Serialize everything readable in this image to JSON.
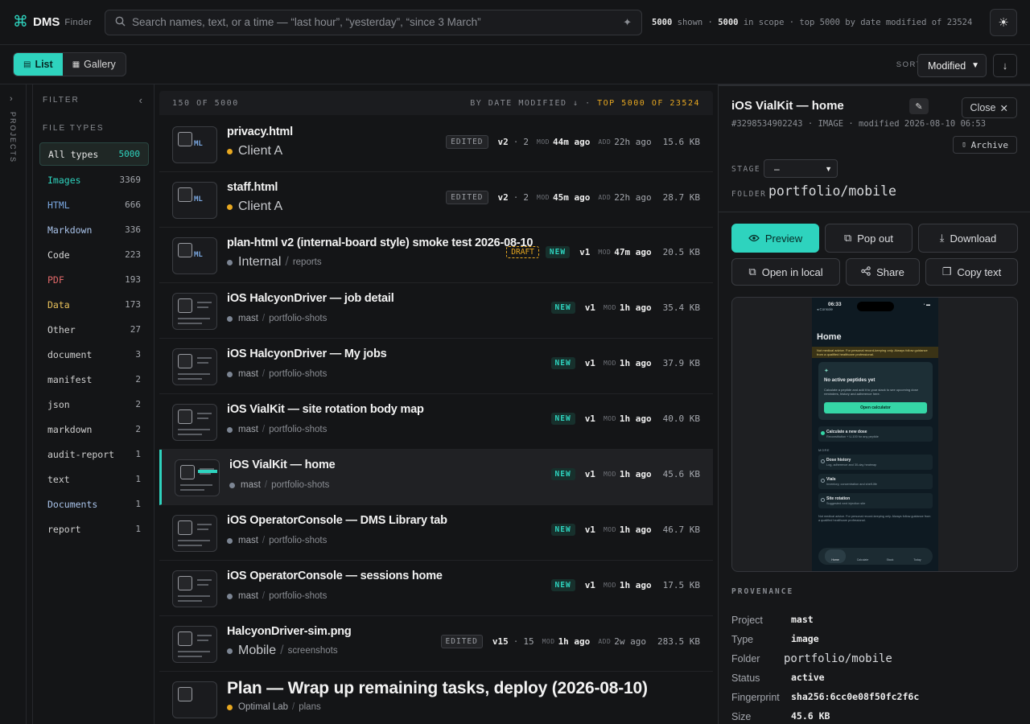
{
  "brand": {
    "name": "DMS",
    "sub": "Finder"
  },
  "search": {
    "placeholder": "Search names, text, or a time — “last hour”, “yesterday”, “since 3 March”"
  },
  "scope": {
    "shown": "5000",
    "shown_label": "shown",
    "in_scope": "5000",
    "in_scope_label": "in scope",
    "top_label": "top 5000 by date modified of 23524"
  },
  "toolbar": {
    "list_label": "List",
    "gallery_label": "Gallery",
    "sort_label": "SORT",
    "sort_value": "Modified"
  },
  "rail": {
    "label": "PROJECTS"
  },
  "filter": {
    "title": "FILTER",
    "file_types_title": "FILE TYPES",
    "items": [
      {
        "label": "All types",
        "count": "5000",
        "color": "#e6e6e6"
      },
      {
        "label": "Images",
        "count": "3369",
        "color": "#2ed3be"
      },
      {
        "label": "HTML",
        "count": "666",
        "color": "#7aa7e0"
      },
      {
        "label": "Markdown",
        "count": "336",
        "color": "#a9c3ea"
      },
      {
        "label": "Code",
        "count": "223",
        "color": "#d8d8d8"
      },
      {
        "label": "PDF",
        "count": "193",
        "color": "#e06868"
      },
      {
        "label": "Data",
        "count": "173",
        "color": "#e8c05a"
      },
      {
        "label": "Other",
        "count": "27",
        "color": "#cfcfcf"
      },
      {
        "label": "document",
        "count": "3",
        "color": "#cfcfcf"
      },
      {
        "label": "manifest",
        "count": "2",
        "color": "#cfcfcf"
      },
      {
        "label": "json",
        "count": "2",
        "color": "#cfcfcf"
      },
      {
        "label": "markdown",
        "count": "2",
        "color": "#cfcfcf"
      },
      {
        "label": "audit-report",
        "count": "1",
        "color": "#cfcfcf"
      },
      {
        "label": "text",
        "count": "1",
        "color": "#cfcfcf"
      },
      {
        "label": "Documents",
        "count": "1",
        "color": "#a9c3ea"
      },
      {
        "label": "report",
        "count": "1",
        "color": "#cfcfcf"
      }
    ]
  },
  "list": {
    "count_label": "150 OF 5000",
    "sort_label": "BY DATE MODIFIED ↓ ·",
    "sort_highlight": "TOP 5000 OF 23524",
    "rows": [
      {
        "title": "privacy.html",
        "project": "Client A",
        "folder": "",
        "badge": "EDITED",
        "version": "v2",
        "extra": "2",
        "mod": "44m ago",
        "add": "22h ago",
        "size": "15.6 KB",
        "thumb": "ml"
      },
      {
        "title": "staff.html",
        "project": "Client A",
        "folder": "",
        "badge": "EDITED",
        "version": "v2",
        "extra": "2",
        "mod": "45m ago",
        "add": "22h ago",
        "size": "28.7 KB",
        "thumb": "ml"
      },
      {
        "title": "plan-html v2 (internal-board style) smoke test 2026-08-10",
        "project": "Internal",
        "folder": "reports",
        "badge": "NEW",
        "draft": "DRAFT",
        "version": "v1",
        "extra": "",
        "mod": "47m ago",
        "add": "",
        "size": "20.5 KB",
        "thumb": "ml"
      },
      {
        "title": "iOS HalcyonDriver — job detail",
        "project": "mast",
        "folder": "portfolio-shots",
        "badge": "NEW",
        "version": "v1",
        "extra": "",
        "mod": "1h ago",
        "add": "",
        "size": "35.4 KB",
        "thumb": "shot"
      },
      {
        "title": "iOS HalcyonDriver — My jobs",
        "project": "mast",
        "folder": "portfolio-shots",
        "badge": "NEW",
        "version": "v1",
        "extra": "",
        "mod": "1h ago",
        "add": "",
        "size": "37.9 KB",
        "thumb": "shot"
      },
      {
        "title": "iOS VialKit — site rotation body map",
        "project": "mast",
        "folder": "portfolio-shots",
        "badge": "NEW",
        "version": "v1",
        "extra": "",
        "mod": "1h ago",
        "add": "",
        "size": "40.0 KB",
        "thumb": "shot"
      },
      {
        "title": "iOS VialKit — home",
        "project": "mast",
        "folder": "portfolio-shots",
        "badge": "NEW",
        "version": "v1",
        "extra": "",
        "mod": "1h ago",
        "add": "",
        "size": "45.6 KB",
        "thumb": "teal",
        "selected": true
      },
      {
        "title": "iOS OperatorConsole — DMS Library tab",
        "project": "mast",
        "folder": "portfolio-shots",
        "badge": "NEW",
        "version": "v1",
        "extra": "",
        "mod": "1h ago",
        "add": "",
        "size": "46.7 KB",
        "thumb": "shot"
      },
      {
        "title": "iOS OperatorConsole — sessions home",
        "project": "mast",
        "folder": "portfolio-shots",
        "badge": "NEW",
        "version": "v1",
        "extra": "",
        "mod": "1h ago",
        "add": "",
        "size": "17.5 KB",
        "thumb": "shot"
      },
      {
        "title": "HalcyonDriver-sim.png",
        "project": "Mobile",
        "folder": "screenshots",
        "badge": "EDITED",
        "version": "v15",
        "extra": "15",
        "mod": "1h ago",
        "add": "2w ago",
        "size": "283.5 KB",
        "thumb": "shot"
      },
      {
        "title": "Plan — Wrap up remaining tasks, deploy (2026-08-10)",
        "project": "Optimal Lab",
        "folder": "plans",
        "badge": "",
        "version": "",
        "extra": "",
        "mod": "",
        "add": "",
        "size": "",
        "thumb": "none",
        "big": true
      }
    ]
  },
  "detail": {
    "title": "iOS VialKit — home",
    "id_line": "#3298534902243 · IMAGE · modified 2026-08-10 06:53",
    "close_label": "Close",
    "archive_label": "Archive",
    "stage_label": "STAGE",
    "stage_value": "–",
    "folder_label": "FOLDER",
    "folder_value": "portfolio/mobile",
    "actions": {
      "preview": "Preview",
      "popout": "Pop out",
      "download": "Download",
      "open_local": "Open in local",
      "share": "Share",
      "copy_text": "Copy text"
    },
    "phone": {
      "time": "06:33",
      "back": "◂ Console",
      "heading": "Home",
      "warning": "Not medical advice. For personal record-keeping only. Always follow guidance from a qualified healthcare professional.",
      "card_title": "No active peptides yet",
      "card_desc": "Calculate a peptide and add it to your stack to see upcoming dose reminders, history and adherence here.",
      "cta": "Open calculator",
      "calc_title": "Calculate a new dose",
      "calc_sub": "Reconstitution + U-100 for any peptide",
      "more_label": "MORE",
      "rows": [
        {
          "title": "Dose history",
          "sub": "Log, adherence and 30-day heatmap"
        },
        {
          "title": "Vials",
          "sub": "Inventory, concentration and shelf-life"
        },
        {
          "title": "Site rotation",
          "sub": "Suggested next injection site"
        }
      ],
      "disclaimer": "Not medical advice. For personal record-keeping only. Always follow guidance from a qualified healthcare professional.",
      "tabs": [
        "Home",
        "Calculate",
        "Stack",
        "Today"
      ]
    },
    "provenance": {
      "title": "PROVENANCE",
      "rows": [
        {
          "label": "Project",
          "value": "mast"
        },
        {
          "label": "Type",
          "value": "image"
        },
        {
          "label": "Folder",
          "value": "portfolio/mobile"
        },
        {
          "label": "Status",
          "value": "active"
        },
        {
          "label": "Fingerprint",
          "value": "sha256:6cc0e08f50fc2f6c"
        },
        {
          "label": "Size",
          "value": "45.6 KB"
        }
      ]
    }
  },
  "colors": {
    "accent": "#2ed3be",
    "amber": "#e8a820",
    "bg": "#141517"
  }
}
